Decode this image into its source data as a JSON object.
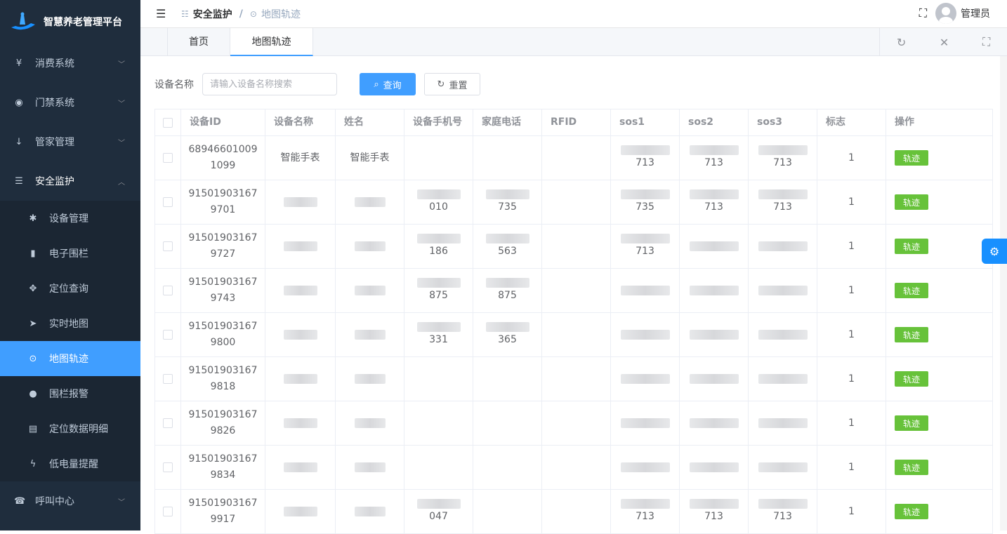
{
  "app": {
    "title": "智慧养老管理平台"
  },
  "sidebar": {
    "items": [
      {
        "label": "消费系统",
        "icon": "yen-icon"
      },
      {
        "label": "门禁系统",
        "icon": "eye-icon"
      },
      {
        "label": "管家管理",
        "icon": "arrow-down-icon"
      },
      {
        "label": "安全监护",
        "icon": "list-icon",
        "open": true
      }
    ],
    "sub": [
      {
        "label": "设备管理",
        "icon": "bug-icon"
      },
      {
        "label": "电子围栏",
        "icon": "bar-chart-icon"
      },
      {
        "label": "定位查询",
        "icon": "move-icon"
      },
      {
        "label": "实时地图",
        "icon": "send-icon"
      },
      {
        "label": "地图轨迹",
        "icon": "location-icon",
        "active": true
      },
      {
        "label": "围栏报警",
        "icon": "globe-icon"
      },
      {
        "label": "定位数据明细",
        "icon": "document-icon"
      },
      {
        "label": "低电量提醒",
        "icon": "lightning-icon"
      }
    ],
    "bottom": {
      "label": "呼叫中心",
      "icon": "phone-icon"
    }
  },
  "header": {
    "crumb1": "安全监护",
    "crumb2": "地图轨迹",
    "user": "管理员"
  },
  "tabs": {
    "home": "首页",
    "active": "地图轨迹"
  },
  "search": {
    "label": "设备名称",
    "placeholder": "请输入设备名称搜索",
    "query": "查询",
    "reset": "重置"
  },
  "table": {
    "headers": [
      "设备ID",
      "设备名称",
      "姓名",
      "设备手机号",
      "家庭电话",
      "RFID",
      "sos1",
      "sos2",
      "sos3",
      "标志",
      "操作"
    ],
    "rows": [
      {
        "id1": "68946601009",
        "id2": "1099",
        "name": "智能手表",
        "xm": "智能手表",
        "phone": "",
        "home": "",
        "s1": "713",
        "s2": "713",
        "s3": "713",
        "flag": "1"
      },
      {
        "id1": "91501903167",
        "id2": "9701",
        "name": "",
        "xm": "",
        "phone": "010",
        "home": "735",
        "s1": "735",
        "s2": "713",
        "s3": "713",
        "flag": "1"
      },
      {
        "id1": "91501903167",
        "id2": "9727",
        "name": "",
        "xm": "",
        "phone": "186",
        "home": "563",
        "s1": "713",
        "s2": "",
        "s3": "",
        "flag": "1"
      },
      {
        "id1": "91501903167",
        "id2": "9743",
        "name": "",
        "xm": "",
        "phone": "875",
        "home": "875",
        "s1": "",
        "s2": "",
        "s3": "",
        "flag": "1"
      },
      {
        "id1": "91501903167",
        "id2": "9800",
        "name": "",
        "xm": "",
        "phone": "331",
        "home": "365",
        "s1": "",
        "s2": "",
        "s3": "",
        "flag": "1"
      },
      {
        "id1": "91501903167",
        "id2": "9818",
        "name": "",
        "xm": "",
        "phone": "",
        "home": "",
        "s1": "",
        "s2": "",
        "s3": "",
        "flag": "1"
      },
      {
        "id1": "91501903167",
        "id2": "9826",
        "name": "",
        "xm": "",
        "phone": "",
        "home": "",
        "s1": "",
        "s2": "",
        "s3": "",
        "flag": "1"
      },
      {
        "id1": "91501903167",
        "id2": "9834",
        "name": "",
        "xm": "",
        "phone": "",
        "home": "",
        "s1": "",
        "s2": "",
        "s3": "",
        "flag": "1"
      },
      {
        "id1": "91501903167",
        "id2": "9917",
        "name": "",
        "xm": "",
        "phone": "047",
        "home": "",
        "s1": "713",
        "s2": "713",
        "s3": "713",
        "flag": "1"
      }
    ],
    "action": "轨迹"
  }
}
